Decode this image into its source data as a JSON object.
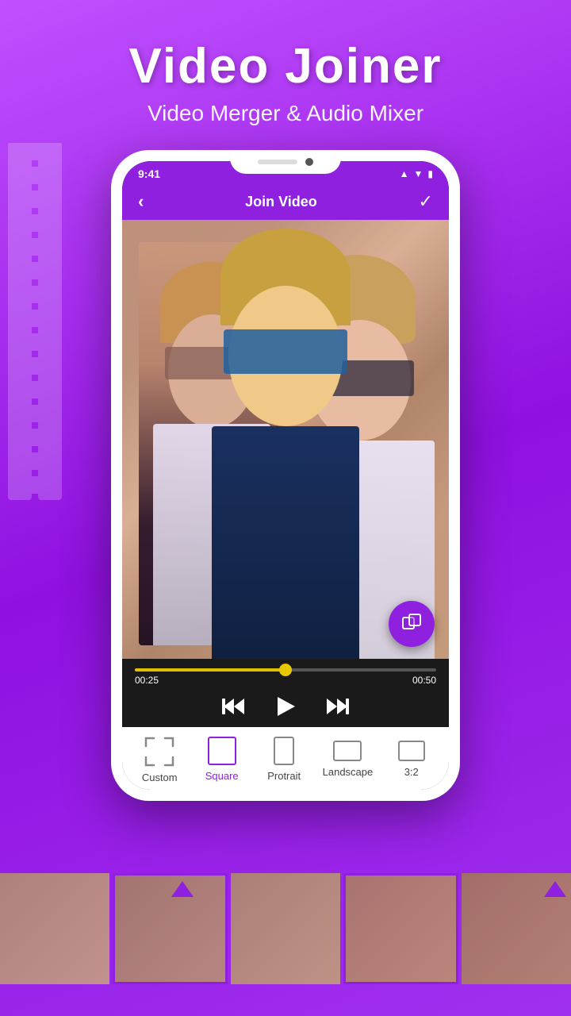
{
  "app": {
    "title": "Video Joiner",
    "subtitle": "Video Merger & Audio Mixer"
  },
  "toolbar": {
    "back_label": "‹",
    "screen_title": "Join Video",
    "check_label": "✓"
  },
  "status_bar": {
    "time": "9:41",
    "signal": "▲",
    "wifi": "▼",
    "battery": "🔋"
  },
  "video": {
    "current_time": "00:25",
    "total_time": "00:50",
    "progress_percent": 50
  },
  "controls": {
    "skip_back": "⏮",
    "play": "▶",
    "skip_forward": "⏭"
  },
  "aspect_ratios": [
    {
      "id": "custom",
      "label": "Custom",
      "active": false
    },
    {
      "id": "square",
      "label": "Square",
      "active": true
    },
    {
      "id": "portrait",
      "label": "Protrait",
      "active": false
    },
    {
      "id": "landscape",
      "label": "Landscape",
      "active": false
    },
    {
      "id": "ratio32",
      "label": "3:2",
      "active": false
    }
  ],
  "fab": {
    "icon": "⧉"
  },
  "colors": {
    "primary": "#9020e0",
    "accent": "#e8c800"
  }
}
